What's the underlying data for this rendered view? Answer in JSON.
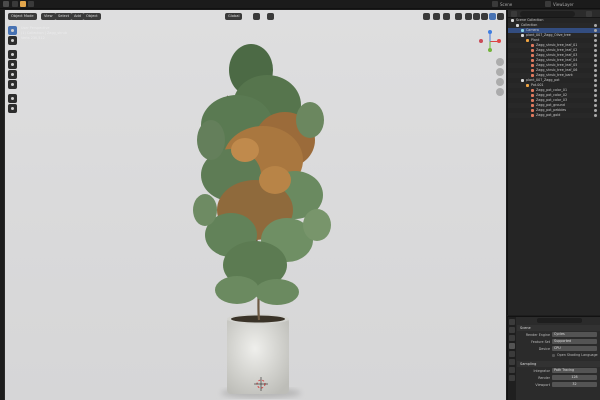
{
  "topbar": {
    "scene_label": "Scene",
    "view_layer_label": "ViewLayer"
  },
  "viewport": {
    "mode_label": "Object Mode",
    "menu": [
      "View",
      "Select",
      "Add",
      "Object"
    ],
    "orientation_label": "Global",
    "options_label": "Options",
    "info_lines": [
      "User Perspective",
      "(1) Collection | Zagg_shrub",
      "Verts 230,512"
    ]
  },
  "outliner": {
    "search_placeholder": "",
    "rows": [
      {
        "label": "Scene Collection",
        "type": "scene",
        "indent": 0
      },
      {
        "label": "Collection",
        "type": "collection",
        "indent": 1
      },
      {
        "label": "Camera",
        "type": "camera",
        "indent": 2,
        "selected": true
      },
      {
        "label": "plant_007_Zagg_Olive_tree",
        "type": "collection",
        "indent": 2
      },
      {
        "label": "Plant",
        "type": "object",
        "indent": 3
      },
      {
        "label": "Zagg_shrub_tree_leaf_01",
        "type": "mesh",
        "indent": 4
      },
      {
        "label": "Zagg_shrub_tree_leaf_02",
        "type": "mesh",
        "indent": 4
      },
      {
        "label": "Zagg_shrub_tree_leaf_03",
        "type": "mesh",
        "indent": 4
      },
      {
        "label": "Zagg_shrub_tree_leaf_04",
        "type": "mesh",
        "indent": 4
      },
      {
        "label": "Zagg_shrub_tree_leaf_05",
        "type": "mesh",
        "indent": 4
      },
      {
        "label": "Zagg_shrub_tree_leaf_06",
        "type": "mesh",
        "indent": 4
      },
      {
        "label": "Zagg_shrub_tree_bark",
        "type": "mesh",
        "indent": 4
      },
      {
        "label": "plant_007_Zagg_pot",
        "type": "collection",
        "indent": 2
      },
      {
        "label": "Pot.001",
        "type": "object",
        "indent": 3
      },
      {
        "label": "Zagg_pot_color_01",
        "type": "mesh",
        "indent": 4
      },
      {
        "label": "Zagg_pot_color_02",
        "type": "mesh",
        "indent": 4
      },
      {
        "label": "Zagg_pot_color_03",
        "type": "mesh",
        "indent": 4
      },
      {
        "label": "Zagg_pot_ground",
        "type": "mesh",
        "indent": 4
      },
      {
        "label": "Zagg_pot_pebbles",
        "type": "mesh",
        "indent": 4
      },
      {
        "label": "Zagg_pot_gold",
        "type": "mesh",
        "indent": 4
      }
    ]
  },
  "properties": {
    "panel_title": "Scene",
    "render_engine_label": "Render Engine",
    "render_engine_value": "Cycles",
    "feature_set_label": "Feature Set",
    "feature_set_value": "Supported",
    "device_label": "Device",
    "device_value": "CPU",
    "osl_label": "Open Shading Language",
    "sampling_label": "Sampling",
    "integrator_label": "Integrator",
    "integrator_value": "Path Tracing",
    "render_label": "Render",
    "render_value": "128",
    "viewport_label": "Viewport",
    "viewport_value": "32"
  },
  "colors": {
    "accent": "#4772b3",
    "collection": "#d8d8d8",
    "mesh": "#e07a5f",
    "object": "#f0a442",
    "camera": "#8ad1e0"
  }
}
